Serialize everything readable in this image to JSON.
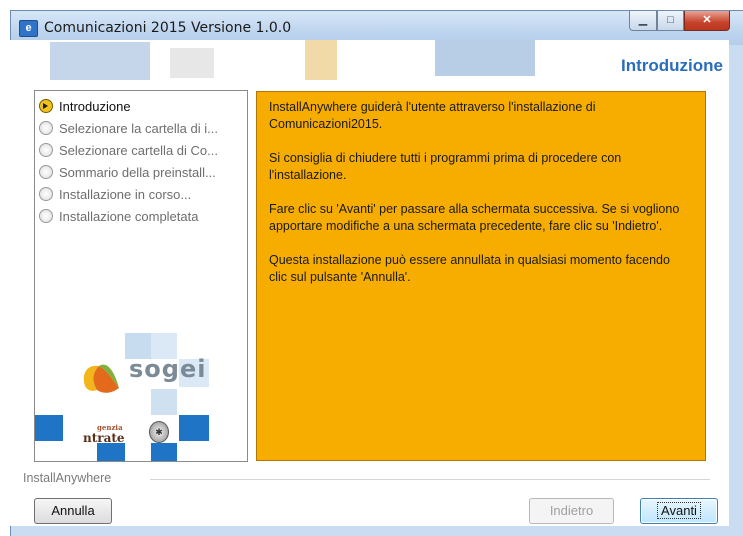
{
  "window": {
    "title": "Comunicazioni 2015 Versione 1.0.0",
    "icon": "app-icon"
  },
  "header": {
    "title": "Introduzione"
  },
  "steps": [
    {
      "label": "Introduzione",
      "active": true
    },
    {
      "label": "Selezionare la cartella di i...",
      "active": false
    },
    {
      "label": "Selezionare cartella di Co...",
      "active": false
    },
    {
      "label": "Sommario della preinstall...",
      "active": false
    },
    {
      "label": "Installazione in corso...",
      "active": false
    },
    {
      "label": "Installazione completata",
      "active": false
    }
  ],
  "logos": {
    "sogei": "sogei",
    "agenzia_line1": "genzia",
    "agenzia_line2": "ntrate"
  },
  "content": {
    "paragraphs": [
      "InstallAnywhere guiderà l'utente attraverso l'installazione di Comunicazioni2015.",
      "Si consiglia di chiudere tutti i programmi prima di procedere con l'installazione.",
      "Fare clic su 'Avanti' per passare alla schermata successiva. Se si vogliono apportare modifiche a una schermata precedente, fare clic su 'Indietro'.",
      "Questa installazione può essere annullata in qualsiasi momento facendo clic sul pulsante 'Annulla'."
    ],
    "background": "#f7ad00"
  },
  "footer": {
    "brand": "InstallAnywhere",
    "annulla": "Annulla",
    "indietro": "Indietro",
    "avanti": "Avanti"
  },
  "colors": {
    "accent": "#2a6ebb",
    "active_step_icon": "#f1c21b"
  }
}
